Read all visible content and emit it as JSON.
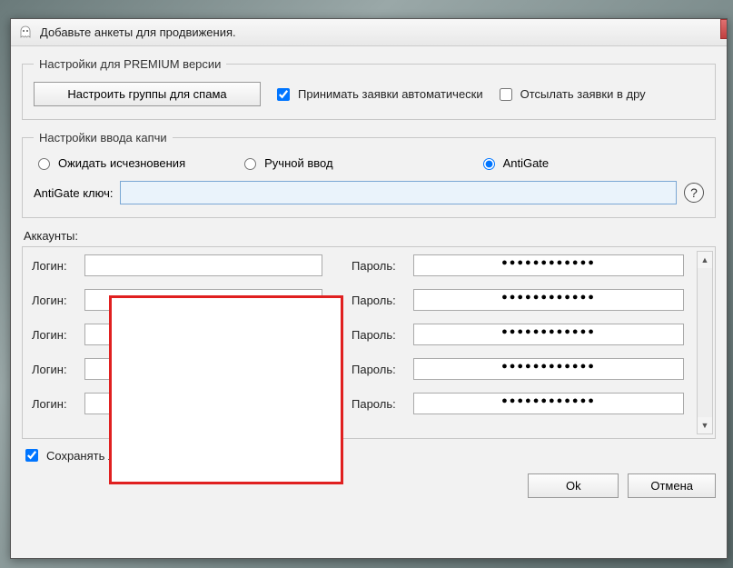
{
  "window": {
    "title": "Добавьте анкеты для продвижения."
  },
  "premium": {
    "legend": "Настройки для PREMIUM версии",
    "spam_button": "Настроить группы для спама",
    "accept_requests_label": "Принимать заявки автоматически",
    "send_requests_label": "Отсылать заявки в дру"
  },
  "captcha": {
    "legend": "Настройки ввода капчи",
    "wait_label": "Ожидать исчезновения",
    "manual_label": "Ручной ввод",
    "antigate_label": "AntiGate",
    "key_label": "AntiGate ключ:",
    "key_value": ""
  },
  "accounts": {
    "header": "Аккаунты:",
    "login_label": "Логин:",
    "password_label": "Пароль:",
    "rows": [
      {
        "login": "",
        "password": "●●●●●●●●●●●●"
      },
      {
        "login": "",
        "password": "●●●●●●●●●●●●"
      },
      {
        "login": "",
        "password": "●●●●●●●●●●●●"
      },
      {
        "login": "",
        "password": "●●●●●●●●●●●●"
      },
      {
        "login": "",
        "password": "●●●●●●●●●●●●"
      }
    ]
  },
  "savelog": {
    "label": "Сохранять лог в VK10000Friends_log.html"
  },
  "dialog": {
    "ok": "Ok",
    "cancel": "Отмена"
  }
}
